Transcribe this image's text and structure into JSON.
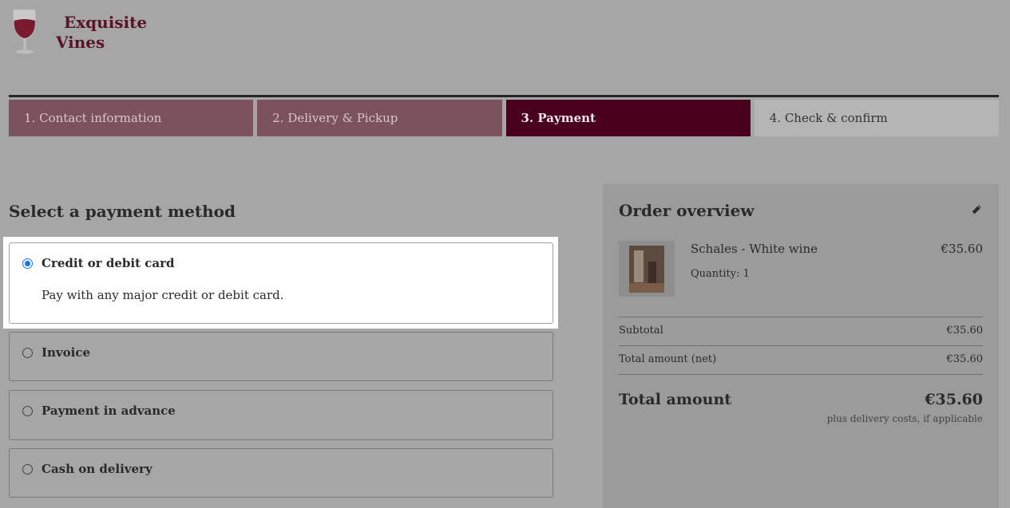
{
  "brand": {
    "line1": "Exquisite",
    "line2": "Vines"
  },
  "steps": [
    {
      "label": "1. Contact information",
      "state": "done"
    },
    {
      "label": "2. Delivery & Pickup",
      "state": "done"
    },
    {
      "label": "3. Payment",
      "state": "active"
    },
    {
      "label": "4. Check & confirm",
      "state": "todo"
    }
  ],
  "payment": {
    "title": "Select a payment method",
    "methods": [
      {
        "label": "Credit or debit card",
        "description": "Pay with any major credit or debit card.",
        "selected": true
      },
      {
        "label": "Invoice",
        "selected": false
      },
      {
        "label": "Payment in advance",
        "selected": false
      },
      {
        "label": "Cash on delivery",
        "selected": false
      }
    ]
  },
  "overview": {
    "title": "Order overview",
    "item": {
      "name": "Schales - White wine",
      "price": "€35.60",
      "quantity": "Quantity: 1"
    },
    "subtotal_label": "Subtotal",
    "subtotal_value": "€35.60",
    "net_label": "Total amount (net)",
    "net_value": "€35.60",
    "total_label": "Total amount",
    "total_value": "€35.60",
    "total_note": "plus delivery costs, if applicable"
  },
  "colors": {
    "brand": "#5a1428",
    "active_step": "#48001c",
    "done_step": "#7b525e",
    "radio": "#1a73e8"
  }
}
